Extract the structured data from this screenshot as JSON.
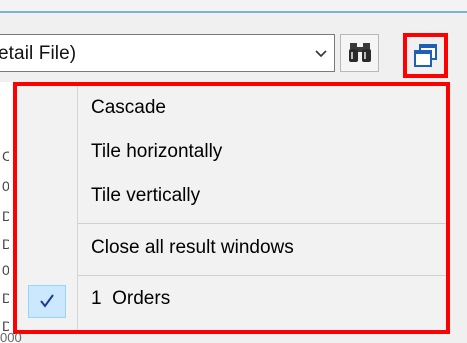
{
  "toolbar": {
    "combo_value": "etail File)",
    "find_icon": "binoculars-icon",
    "window_icon": "windows-cascade-icon",
    "highlight_color": "#ff0000"
  },
  "menu": {
    "items": [
      {
        "label": "Cascade"
      },
      {
        "label": "Tile horizontally"
      },
      {
        "label": "Tile vertically"
      },
      {
        "label": "Close all result windows"
      },
      {
        "label": "1  Orders",
        "checked": true
      }
    ]
  },
  "background_rows": [
    "C",
    "0",
    "D",
    "D",
    "0",
    "D",
    "D"
  ],
  "bottom_stub_text": "000"
}
